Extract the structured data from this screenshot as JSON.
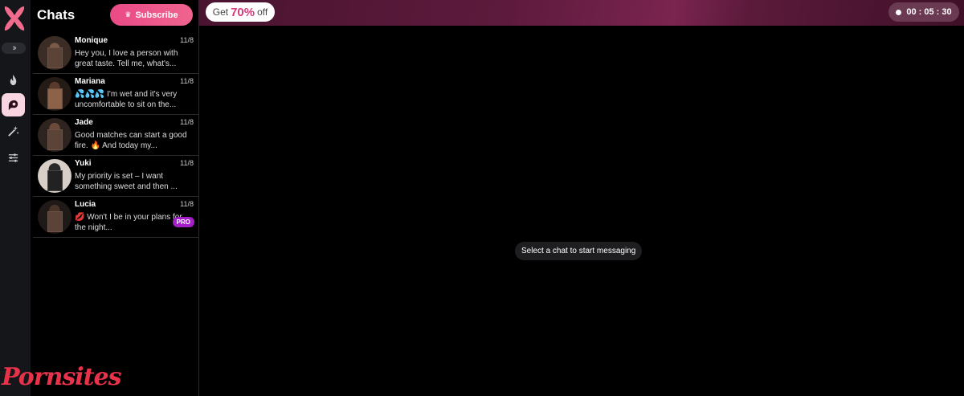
{
  "sidebar": {
    "toggle_icon": "double-chevron-right-icon",
    "nav": [
      {
        "icon": "flame-icon",
        "active": false
      },
      {
        "icon": "chat-bubbles-icon",
        "active": true
      },
      {
        "icon": "magic-wand-icon",
        "active": false
      },
      {
        "icon": "sliders-icon",
        "active": false
      }
    ]
  },
  "chats_panel": {
    "title": "Chats",
    "subscribe_label": "Subscribe",
    "items": [
      {
        "name": "Monique",
        "date": "11/8",
        "preview": "Hey you, I love a person with great taste. Tell me, what's..."
      },
      {
        "name": "Mariana",
        "date": "11/8",
        "preview": "💦💦💦 I'm wet and it's very uncomfortable to sit on the..."
      },
      {
        "name": "Jade",
        "date": "11/8",
        "preview": "Good matches can start a good fire. 🔥 And today my..."
      },
      {
        "name": "Yuki",
        "date": "11/8",
        "preview": "My priority is set – I want something sweet and then ..."
      },
      {
        "name": "Lucia",
        "date": "11/8",
        "preview": "💋 Won't I be in your plans for the night...",
        "badge": "PRO"
      }
    ]
  },
  "banner": {
    "promo_prefix": "Get",
    "promo_value": "70%",
    "promo_suffix": "off",
    "timer": "00 : 05 : 30"
  },
  "main": {
    "empty_message": "Select a chat to start messaging"
  },
  "watermark": "Pornsites",
  "colors": {
    "accent": "#e94a86",
    "pro_badge": "#a51fc9",
    "banner": "#5d1a3c"
  }
}
